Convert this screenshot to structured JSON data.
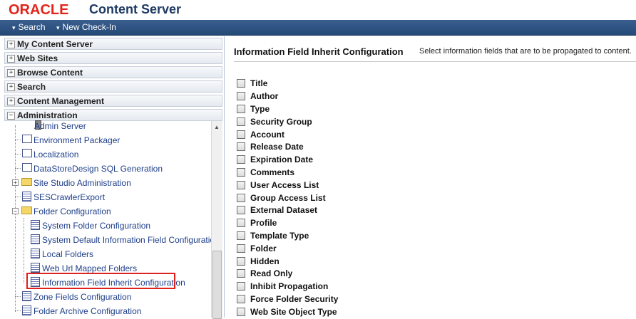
{
  "header": {
    "brand": "ORACLE",
    "product": "Content Server"
  },
  "nav": {
    "search": "Search",
    "new_checkin": "New Check-In"
  },
  "sidebar": {
    "sections": [
      {
        "label": "My Content Server",
        "toggle": "+"
      },
      {
        "label": "Web Sites",
        "toggle": "+"
      },
      {
        "label": "Browse Content",
        "toggle": "+"
      },
      {
        "label": "Search",
        "toggle": "+"
      },
      {
        "label": "Content Management",
        "toggle": "+"
      },
      {
        "label": "Administration",
        "toggle": "−"
      }
    ],
    "tree": [
      {
        "label": "Admin Server",
        "icon": "server-icon"
      },
      {
        "label": "Environment Packager",
        "icon": "window-icon"
      },
      {
        "label": "Localization",
        "icon": "window-icon"
      },
      {
        "label": "DataStoreDesign SQL Generation",
        "icon": "window-icon"
      },
      {
        "label": "Site Studio Administration",
        "icon": "folder-icon"
      },
      {
        "label": "SESCrawlerExport",
        "icon": "page-icon"
      },
      {
        "label": "Folder Configuration",
        "icon": "folder-open-icon"
      },
      {
        "label": "System Folder Configuration",
        "icon": "page-icon"
      },
      {
        "label": "System Default Information Field Configuration",
        "icon": "page-icon"
      },
      {
        "label": "Local Folders",
        "icon": "page-icon"
      },
      {
        "label": "Web Url Mapped Folders",
        "icon": "page-icon"
      },
      {
        "label": "Information Field Inherit Configuration",
        "icon": "page-icon"
      },
      {
        "label": "Zone Fields Configuration",
        "icon": "page-icon"
      },
      {
        "label": "Folder Archive Configuration",
        "icon": "page-icon"
      }
    ]
  },
  "main": {
    "title": "Information Field Inherit Configuration",
    "description": "Select information fields that are to be propagated to content.",
    "fields": [
      "Title",
      "Author",
      "Type",
      "Security Group",
      "Account",
      "Release Date",
      "Expiration Date",
      "Comments",
      "User Access List",
      "Group Access List",
      "External Dataset",
      "Profile",
      "Template Type",
      "Folder",
      "Hidden",
      "Read Only",
      "Inhibit Propagation",
      "Force Folder Security",
      "Web Site Object Type"
    ]
  },
  "colors": {
    "brand_red": "#e3241b",
    "nav_blue": "#2c507f",
    "link_blue": "#1f3f8a",
    "highlight": "#e0201c"
  }
}
